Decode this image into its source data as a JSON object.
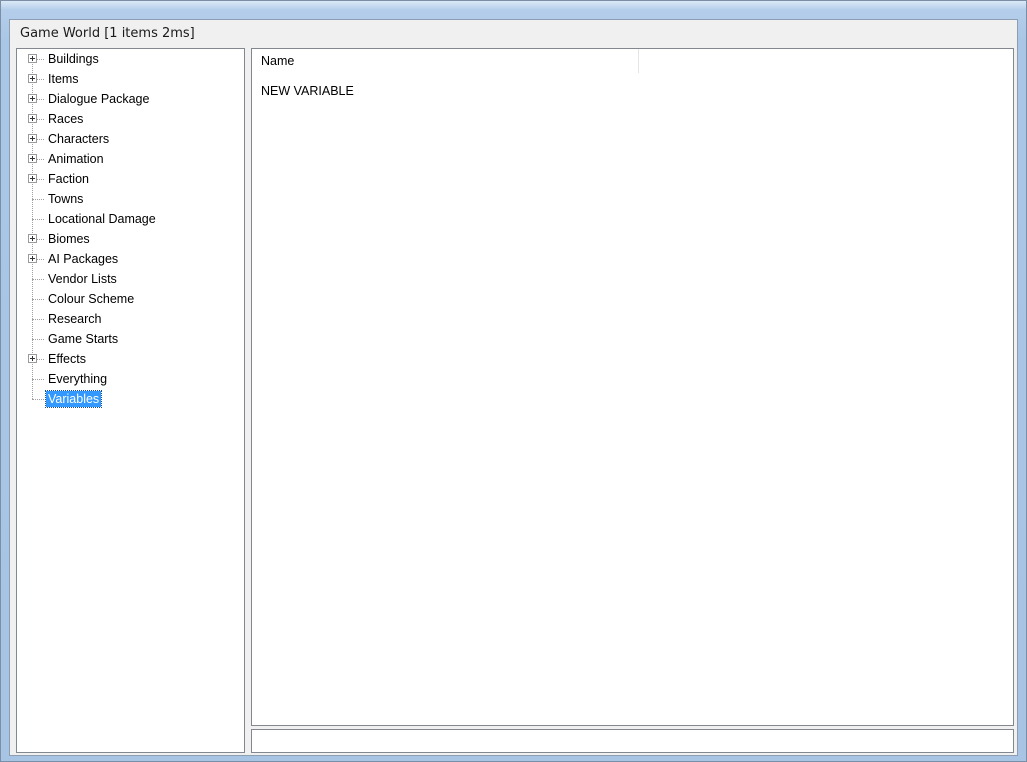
{
  "window": {
    "caption": "Game World [1 items 2ms]"
  },
  "tree": {
    "items": [
      {
        "label": "Buildings",
        "expandable": true
      },
      {
        "label": "Items",
        "expandable": true
      },
      {
        "label": "Dialogue Package",
        "expandable": true
      },
      {
        "label": "Races",
        "expandable": true
      },
      {
        "label": "Characters",
        "expandable": true
      },
      {
        "label": "Animation",
        "expandable": true
      },
      {
        "label": "Faction",
        "expandable": true
      },
      {
        "label": "Towns",
        "expandable": false
      },
      {
        "label": "Locational Damage",
        "expandable": false
      },
      {
        "label": "Biomes",
        "expandable": true
      },
      {
        "label": "AI Packages",
        "expandable": true
      },
      {
        "label": "Vendor Lists",
        "expandable": false
      },
      {
        "label": "Colour Scheme",
        "expandable": false
      },
      {
        "label": "Research",
        "expandable": false
      },
      {
        "label": "Game Starts",
        "expandable": false
      },
      {
        "label": "Effects",
        "expandable": true
      },
      {
        "label": "Everything",
        "expandable": false
      },
      {
        "label": "Variables",
        "expandable": false,
        "selected": true
      }
    ]
  },
  "list": {
    "columns": [
      "Name"
    ],
    "rows": [
      {
        "name": "NEW VARIABLE"
      }
    ]
  },
  "status": {
    "text": ""
  },
  "colors": {
    "selection": "#3399ff",
    "frame": "#a8c4e4"
  }
}
